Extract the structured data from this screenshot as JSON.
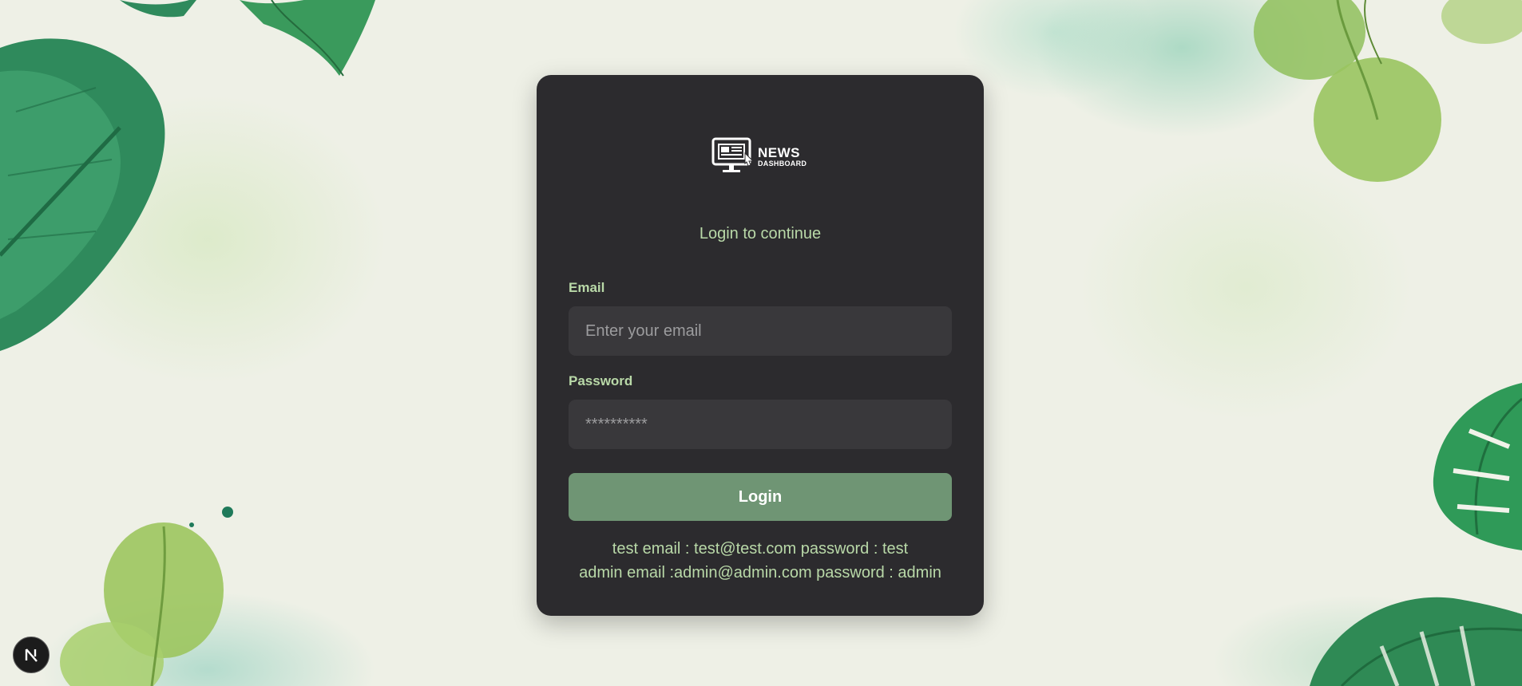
{
  "logo": {
    "line1": "NEWS",
    "line2": "DASHBOARD",
    "icon": "monitor-news-icon"
  },
  "subtitle": "Login to continue",
  "form": {
    "email": {
      "label": "Email",
      "placeholder": "Enter your email",
      "value": ""
    },
    "password": {
      "label": "Password",
      "placeholder": "**********",
      "value": ""
    },
    "submit_label": "Login"
  },
  "credentials": {
    "line1": "test email : test@test.com password : test",
    "line2": "admin email :admin@admin.com password : admin"
  },
  "dev_badge": {
    "icon": "nextjs-logo-icon"
  },
  "colors": {
    "card_background": "#2c2b2e",
    "accent_text": "#b9d9a8",
    "button": "#6f9574",
    "input_background": "#39383b"
  }
}
